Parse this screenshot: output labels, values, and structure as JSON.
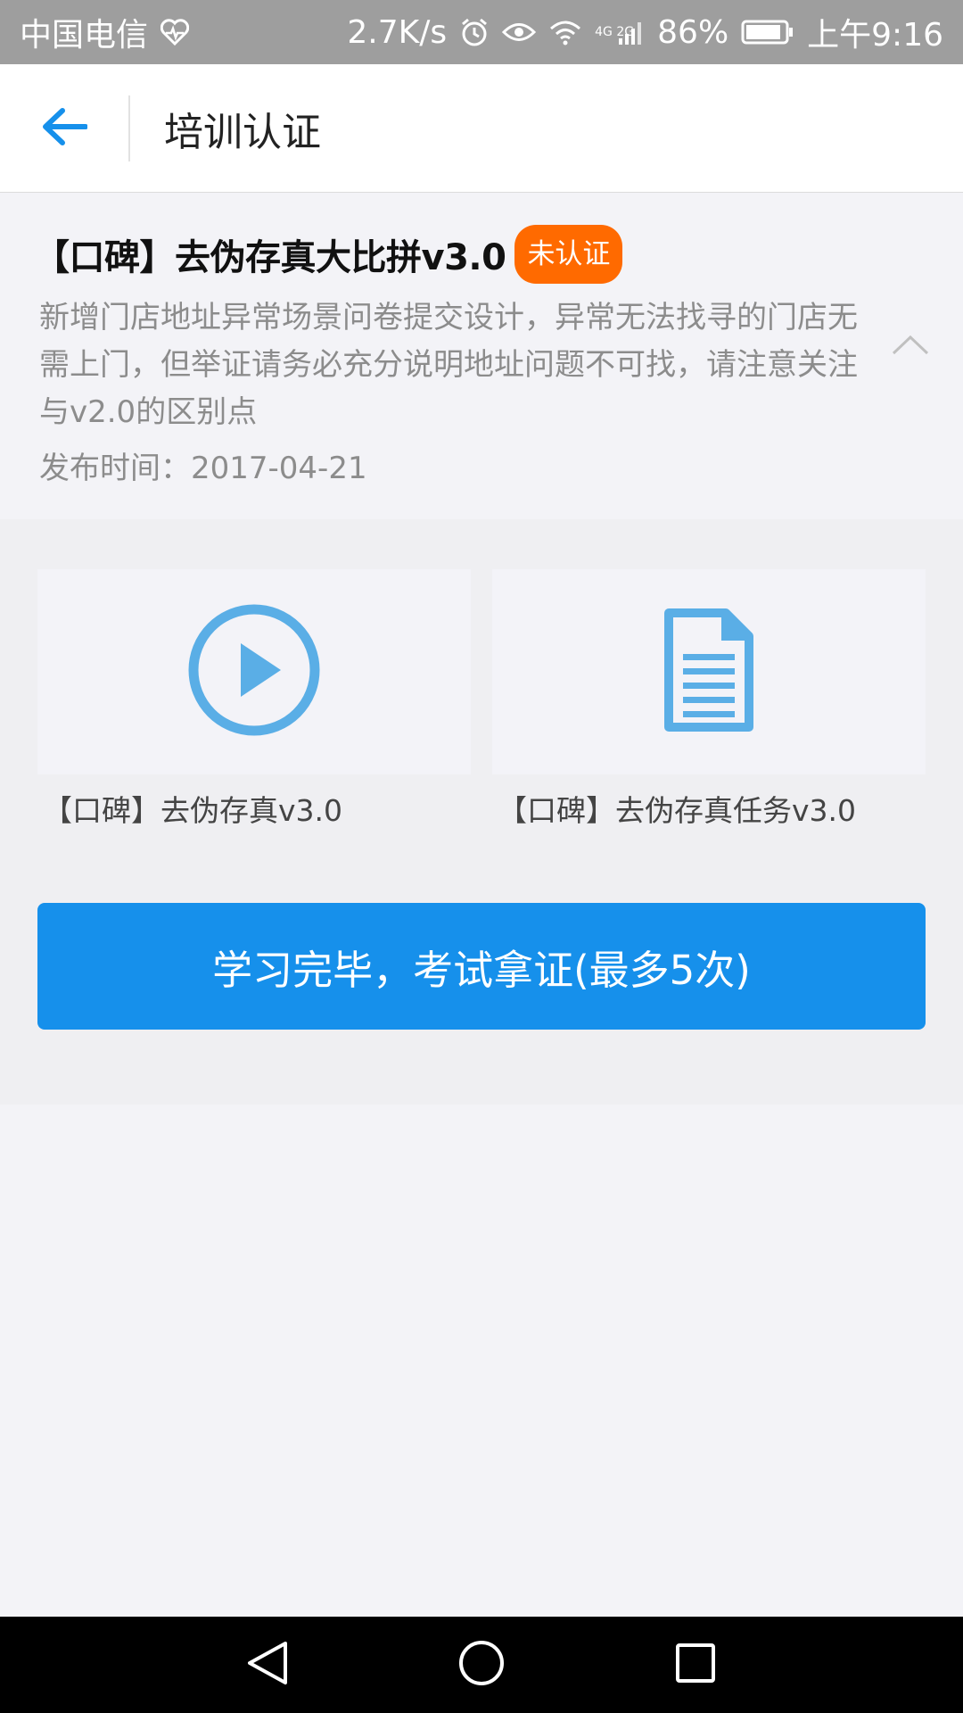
{
  "status_bar": {
    "carrier": "中国电信",
    "speed": "2.7K/s",
    "network": "4G 2G",
    "battery": "86%",
    "time": "上午9:16",
    "icons": [
      "heart-icon",
      "alarm-icon",
      "eye-icon",
      "wifi-icon",
      "signal-icon",
      "battery-icon"
    ]
  },
  "app_bar": {
    "title": "培训认证",
    "back_icon": "arrow-left-icon"
  },
  "course": {
    "title": "【口碑】去伪存真大比拼v3.0",
    "badge": "未认证",
    "description": "新增门店地址异常场景问卷提交设计，异常无法找寻的门店无需上门，但举证请务必充分说明地址问题不可找，请注意关注与v2.0的区别点",
    "publish_time": "发布时间：2017-04-21"
  },
  "materials": [
    {
      "label": "【口碑】去伪存真v3.0",
      "icon": "play-circle-icon"
    },
    {
      "label": "【口碑】去伪存真任务v3.0",
      "icon": "document-icon"
    }
  ],
  "exam_button": {
    "label": "学习完毕，考试拿证(最多5次)"
  },
  "nav_bar": {
    "icons": [
      "nav-back-icon",
      "nav-home-icon",
      "nav-recents-icon"
    ]
  },
  "colors": {
    "accent": "#1690eb",
    "badge": "#ff6a00",
    "icon_blue": "#5aaee6"
  }
}
